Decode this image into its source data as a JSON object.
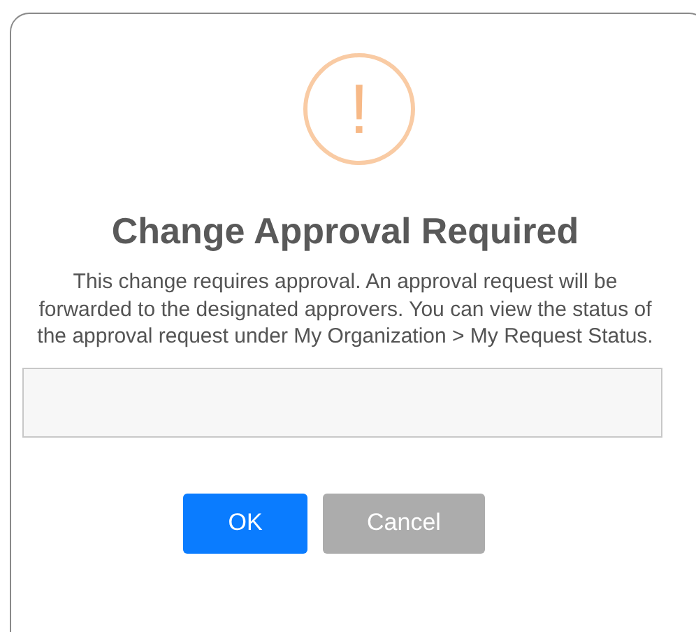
{
  "dialog": {
    "icon_symbol": "!",
    "title": "Change Approval Required",
    "message": "This change requires approval. An approval request will be forwarded to the designated approvers. You can view the status of the approval request under My Organization > My Request Status.",
    "buttons": [
      {
        "label": "OK",
        "kind": "primary"
      },
      {
        "label": "Cancel",
        "kind": "secondary"
      }
    ]
  }
}
